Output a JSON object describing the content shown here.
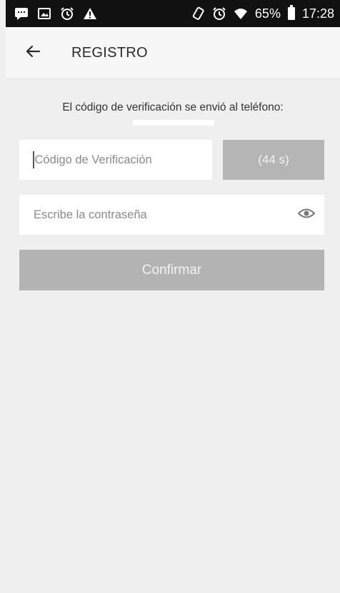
{
  "status_bar": {
    "battery_percent": "65%",
    "time": "17:28",
    "left_icons": [
      "chat-icon",
      "image-icon",
      "alarm-icon",
      "warning-icon"
    ],
    "right_icons": [
      "rotate-icon",
      "alarm-icon",
      "wifi-icon",
      "battery-icon"
    ]
  },
  "app_bar": {
    "title": "REGISTRO",
    "back_icon": "arrow-left-icon"
  },
  "form": {
    "info_text": "El código de verificación se envió al teléfono:",
    "code_placeholder": "Código de Verificación",
    "timer_label": "(44 s)",
    "password_placeholder": "Escribe la contraseña",
    "password_toggle_icon": "eye-icon",
    "confirm_label": "Confirmar"
  },
  "colors": {
    "status_bar_bg": "#111111",
    "app_bar_bg": "#f7f7f7",
    "screen_bg": "#efefef",
    "disabled_button_bg": "#b3b3b3"
  }
}
